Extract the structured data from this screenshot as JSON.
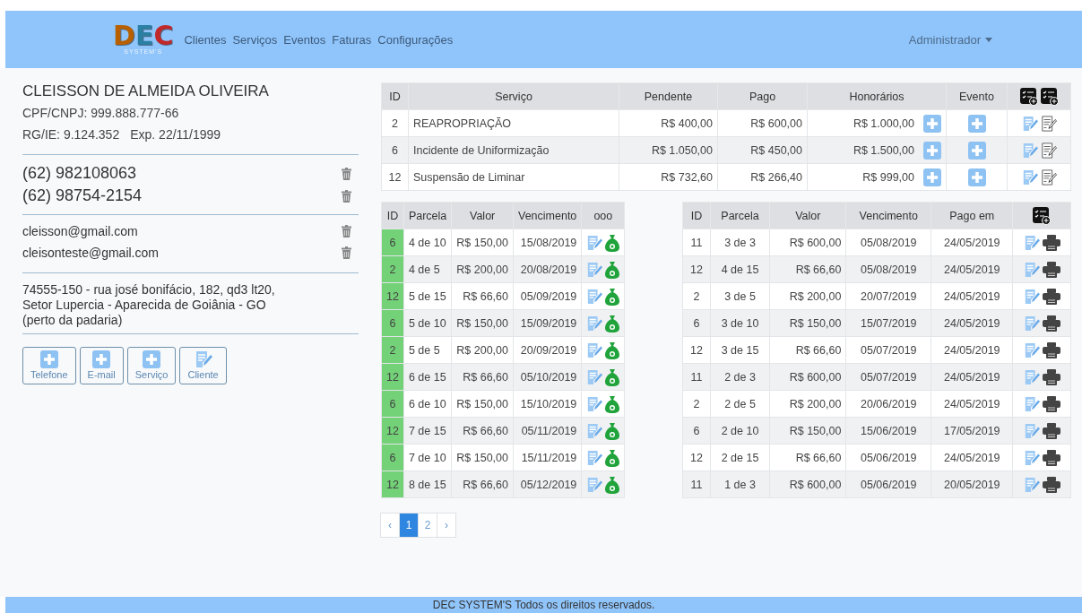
{
  "logo": {
    "letters": [
      "D",
      "E",
      "C"
    ],
    "subtitle": "SYSTEM'S"
  },
  "nav": [
    "Clientes",
    "Serviços",
    "Eventos",
    "Faturas",
    "Configurações"
  ],
  "user_menu": "Administrador",
  "client": {
    "name": "CLEISSON DE ALMEIDA OLIVEIRA",
    "document": "CPF/CNPJ: 999.888.777-66",
    "rg": "RG/IE: 9.124.352",
    "expiry": "Exp. 22/11/1999",
    "phones": [
      "(62) 982108063",
      "(62) 98754-2154"
    ],
    "emails": [
      "cleisson@gmail.com",
      "cleisonteste@gmail.com"
    ],
    "address": [
      "74555-150 - rua josé bonifácio, 182, qd3 lt20,",
      "Setor Lupercia - Aparecida de Goiânia - GO",
      "(perto da padaria)"
    ]
  },
  "add_buttons": [
    {
      "kind": "add",
      "label": "Telefone"
    },
    {
      "kind": "add",
      "label": "E-mail"
    },
    {
      "kind": "add",
      "label": "Serviço"
    },
    {
      "kind": "edit",
      "label": "Cliente"
    }
  ],
  "services": {
    "columns": [
      "ID",
      "Serviço",
      "Pendente",
      "Pago",
      "Honorários",
      "Evento"
    ],
    "rows": [
      {
        "id": "2",
        "service": "REAPROPRIAÇÃO",
        "pending": "R$ 400,00",
        "paid": "R$ 600,00",
        "fees": "R$ 1.000,00"
      },
      {
        "id": "6",
        "service": "Incidente de Uniformização",
        "pending": "R$ 1.050,00",
        "paid": "R$ 450,00",
        "fees": "R$ 1.500,00"
      },
      {
        "id": "12",
        "service": "Suspensão de Liminar",
        "pending": "R$ 732,60",
        "paid": "R$ 266,40",
        "fees": "R$ 999,00"
      }
    ]
  },
  "open_installments": {
    "columns": [
      "ID",
      "Parcela",
      "Valor",
      "Vencimento",
      "ooo"
    ],
    "rows": [
      {
        "id": "6",
        "installment": "4 de 10",
        "value": "R$ 150,00",
        "due": "15/08/2019"
      },
      {
        "id": "2",
        "installment": "4 de 5",
        "value": "R$ 200,00",
        "due": "20/08/2019"
      },
      {
        "id": "12",
        "installment": "5 de 15",
        "value": "R$ 66,60",
        "due": "05/09/2019"
      },
      {
        "id": "6",
        "installment": "5 de 10",
        "value": "R$ 150,00",
        "due": "15/09/2019"
      },
      {
        "id": "2",
        "installment": "5 de 5",
        "value": "R$ 200,00",
        "due": "20/09/2019"
      },
      {
        "id": "12",
        "installment": "6 de 15",
        "value": "R$ 66,60",
        "due": "05/10/2019"
      },
      {
        "id": "6",
        "installment": "6 de 10",
        "value": "R$ 150,00",
        "due": "15/10/2019"
      },
      {
        "id": "12",
        "installment": "7 de 15",
        "value": "R$ 66,60",
        "due": "05/11/2019"
      },
      {
        "id": "6",
        "installment": "7 de 10",
        "value": "R$ 150,00",
        "due": "15/11/2019"
      },
      {
        "id": "12",
        "installment": "8 de 15",
        "value": "R$ 66,60",
        "due": "05/12/2019"
      }
    ]
  },
  "paid_installments": {
    "columns": [
      "ID",
      "Parcela",
      "Valor",
      "Vencimento",
      "Pago em"
    ],
    "rows": [
      {
        "id": "11",
        "installment": "3 de 3",
        "value": "R$ 600,00",
        "due": "05/08/2019",
        "paid_on": "24/05/2019"
      },
      {
        "id": "12",
        "installment": "4 de 15",
        "value": "R$ 66,60",
        "due": "05/08/2019",
        "paid_on": "24/05/2019"
      },
      {
        "id": "2",
        "installment": "3 de 5",
        "value": "R$ 200,00",
        "due": "20/07/2019",
        "paid_on": "24/05/2019"
      },
      {
        "id": "6",
        "installment": "3 de 10",
        "value": "R$ 150,00",
        "due": "15/07/2019",
        "paid_on": "24/05/2019"
      },
      {
        "id": "12",
        "installment": "3 de 15",
        "value": "R$ 66,60",
        "due": "05/07/2019",
        "paid_on": "24/05/2019"
      },
      {
        "id": "11",
        "installment": "2 de 3",
        "value": "R$ 600,00",
        "due": "05/07/2019",
        "paid_on": "24/05/2019"
      },
      {
        "id": "2",
        "installment": "2 de 5",
        "value": "R$ 200,00",
        "due": "20/06/2019",
        "paid_on": "24/05/2019"
      },
      {
        "id": "6",
        "installment": "2 de 10",
        "value": "R$ 150,00",
        "due": "15/06/2019",
        "paid_on": "17/05/2019"
      },
      {
        "id": "12",
        "installment": "2 de 15",
        "value": "R$ 66,60",
        "due": "05/06/2019",
        "paid_on": "24/05/2019"
      },
      {
        "id": "11",
        "installment": "1 de 3",
        "value": "R$ 600,00",
        "due": "05/06/2019",
        "paid_on": "20/05/2019"
      }
    ]
  },
  "pagination": [
    {
      "label": "‹",
      "selected": false
    },
    {
      "label": "1",
      "selected": true
    },
    {
      "label": "2",
      "selected": false
    },
    {
      "label": "›",
      "selected": false
    }
  ],
  "footer": "DEC SYSTEM'S Todos os direitos reservados."
}
